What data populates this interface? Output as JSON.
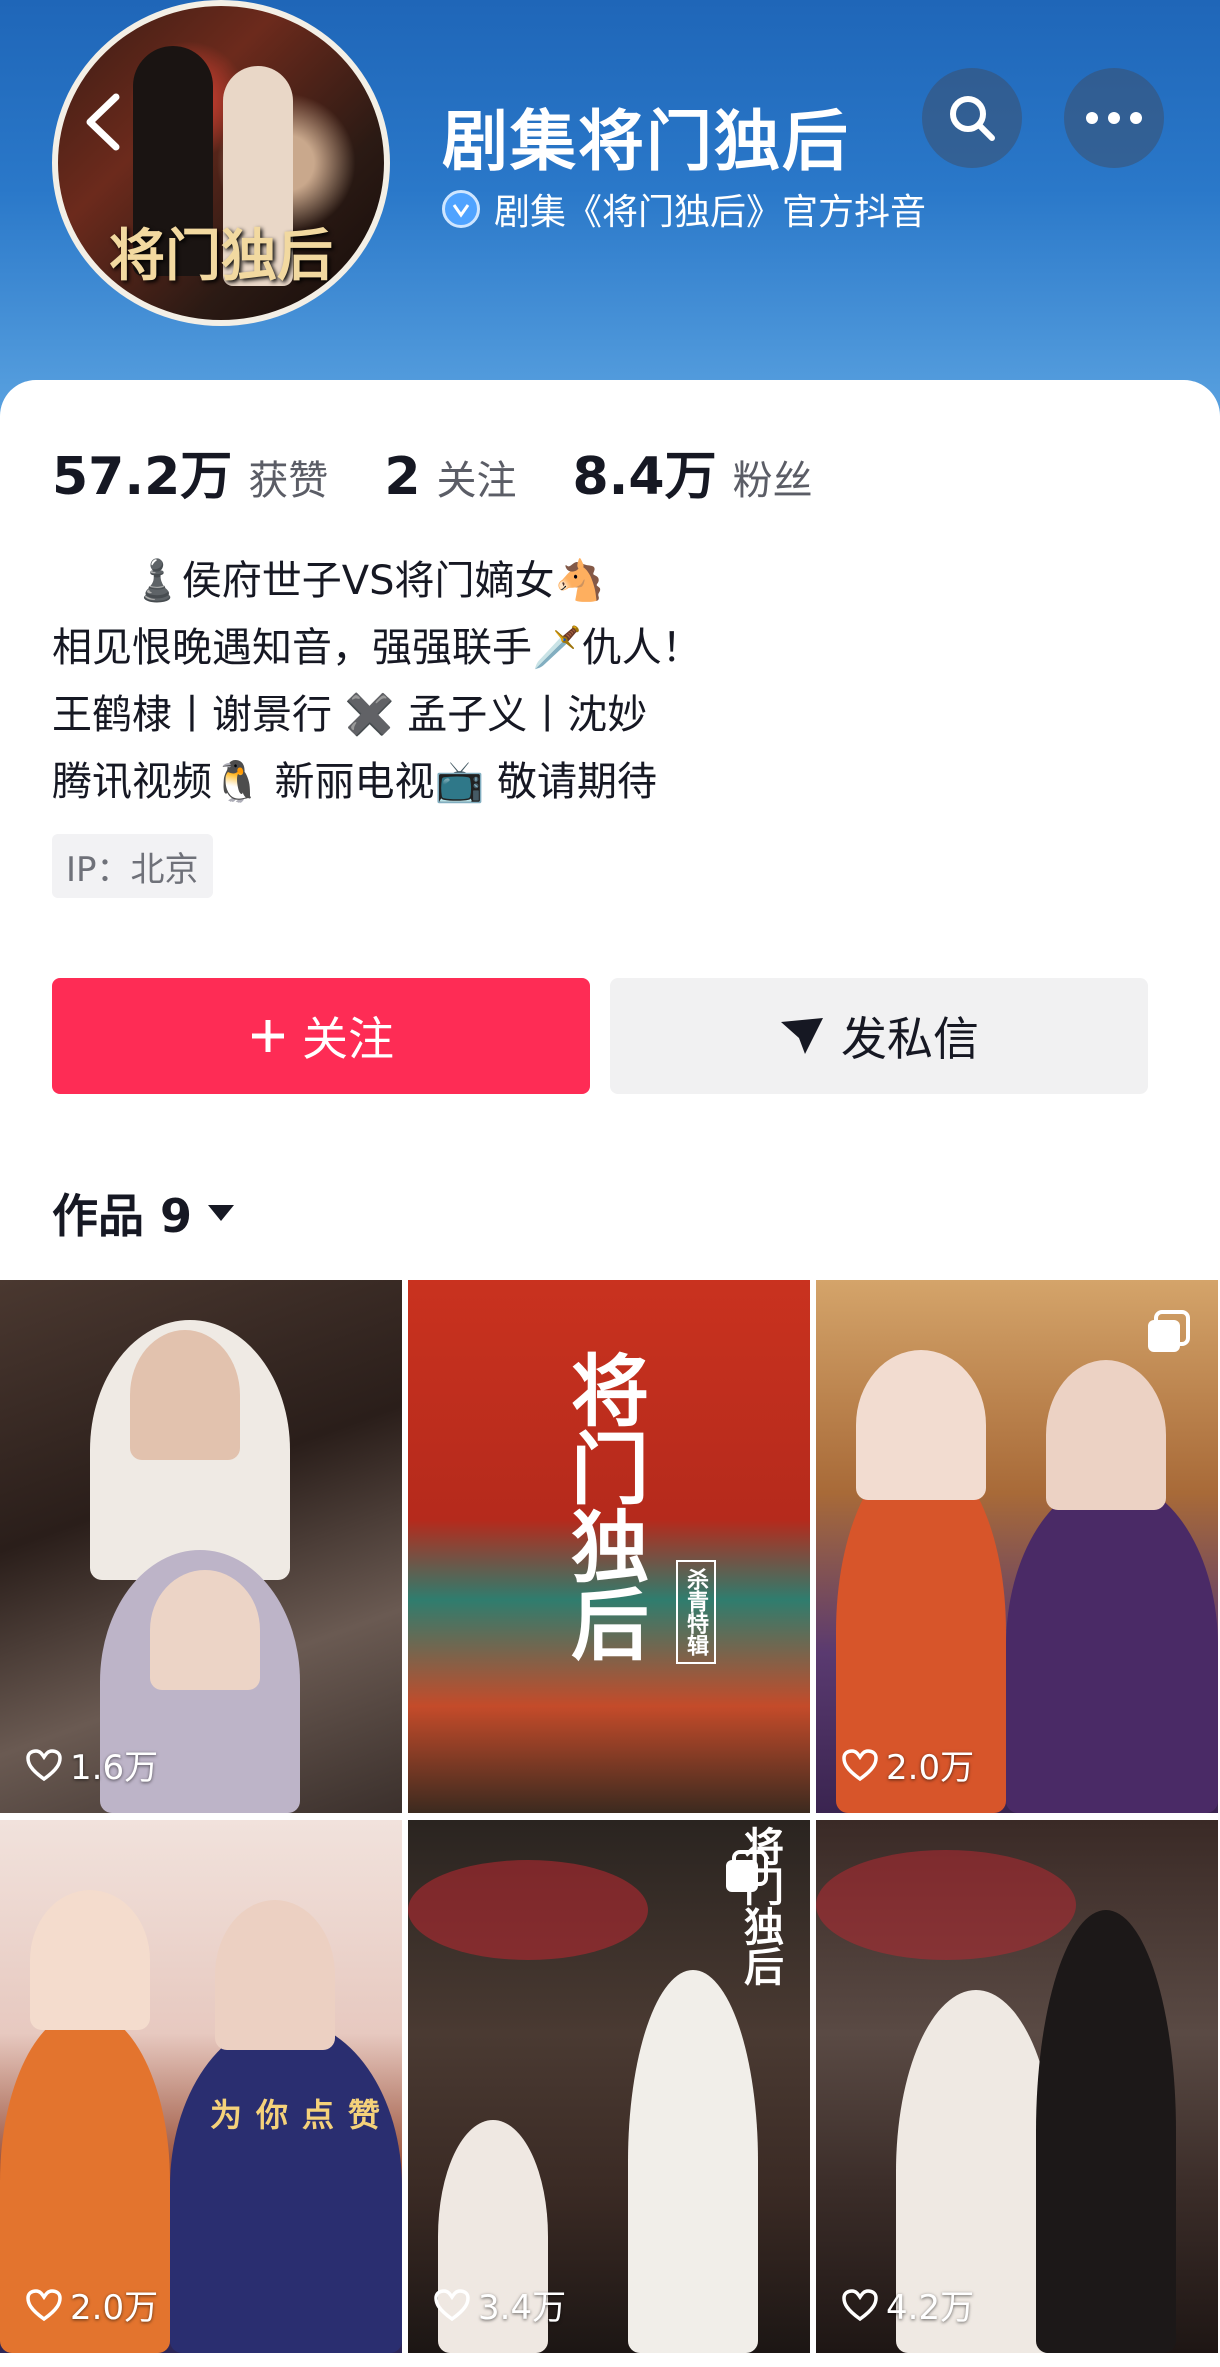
{
  "header": {
    "title": "剧集将门独后",
    "verified_text": "剧集《将门独后》官方抖音",
    "avatar_text": "将门独后",
    "icons": [
      "back-icon",
      "search-icon",
      "more-icon",
      "verified-icon"
    ]
  },
  "stats": [
    {
      "value": "57.2万",
      "label": "获赞"
    },
    {
      "value": "2",
      "label": "关注"
    },
    {
      "value": "8.4万",
      "label": "粉丝"
    }
  ],
  "bio": [
    "♟️侯府世子VS将门嫡女🐴",
    "相见恨晚遇知音，强强联手🗡️仇人！",
    " 王鹤棣丨谢景行 ✖️ 孟子义丨沈妙",
    "腾讯视频🐧 新丽电视📺 敬请期待"
  ],
  "ip": "IP：北京",
  "actions": {
    "follow_label": "关注",
    "message_label": "发私信"
  },
  "works": {
    "tab_label": "作品 9"
  },
  "videos": [
    {
      "likes": "1.6万",
      "multi": false
    },
    {
      "likes": "",
      "multi": false,
      "title": "将门独后",
      "subtitle": "杀青特辑"
    },
    {
      "likes": "2.0万",
      "multi": true
    },
    {
      "likes": "2.0万",
      "multi": false,
      "overlay": "为你点赞"
    },
    {
      "likes": "3.4万",
      "multi": true,
      "title": "将门独后"
    },
    {
      "likes": "4.2万",
      "multi": false
    }
  ],
  "colors": {
    "accent": "#fe2c55",
    "header_blue": "#2a78c9"
  }
}
